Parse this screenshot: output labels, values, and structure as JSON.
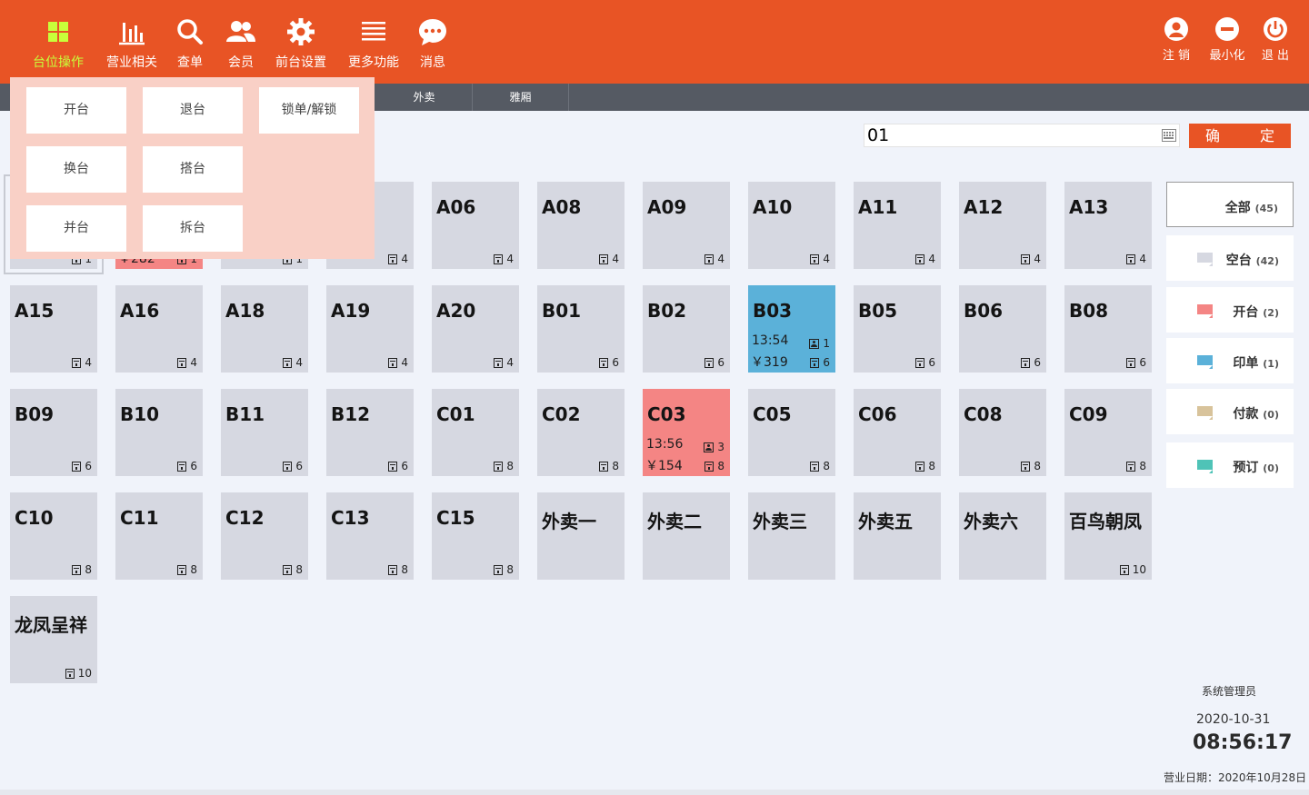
{
  "nav": {
    "items": [
      {
        "label": "台位操作",
        "icon": "grid-icon"
      },
      {
        "label": "营业相关",
        "icon": "bar-chart-icon"
      },
      {
        "label": "查单",
        "icon": "search-icon"
      },
      {
        "label": "会员",
        "icon": "users-icon"
      },
      {
        "label": "前台设置",
        "icon": "gear-icon"
      },
      {
        "label": "更多功能",
        "icon": "menu-icon"
      },
      {
        "label": "消息",
        "icon": "chat-icon"
      }
    ],
    "window": [
      {
        "label": "注 销",
        "icon": "user-logout-icon"
      },
      {
        "label": "最小化",
        "icon": "minimize-icon"
      },
      {
        "label": "退 出",
        "icon": "power-icon"
      }
    ]
  },
  "subtabs": [
    "外卖",
    "雅厢"
  ],
  "search": {
    "value": "01",
    "confirm_label": "确　定"
  },
  "popup": {
    "buttons": [
      "开台",
      "退台",
      "锁单/解锁",
      "换台",
      "搭台",
      "并台",
      "拆台"
    ]
  },
  "tables_partial": [
    {
      "name": "",
      "seats": "1"
    },
    {
      "name": "",
      "amount": "￥282",
      "guests": "1"
    },
    {
      "name": "",
      "seats": "1"
    },
    {
      "name": "",
      "seats": "4"
    }
  ],
  "tables": [
    {
      "name": "A06",
      "seats": "4",
      "status": "empty"
    },
    {
      "name": "A08",
      "seats": "4",
      "status": "empty"
    },
    {
      "name": "A09",
      "seats": "4",
      "status": "empty"
    },
    {
      "name": "A10",
      "seats": "4",
      "status": "empty"
    },
    {
      "name": "A11",
      "seats": "4",
      "status": "empty"
    },
    {
      "name": "A12",
      "seats": "4",
      "status": "empty"
    },
    {
      "name": "A13",
      "seats": "4",
      "status": "empty"
    },
    {
      "name": "A15",
      "seats": "4",
      "status": "empty"
    },
    {
      "name": "A16",
      "seats": "4",
      "status": "empty"
    },
    {
      "name": "A18",
      "seats": "4",
      "status": "empty"
    },
    {
      "name": "A19",
      "seats": "4",
      "status": "empty"
    },
    {
      "name": "A20",
      "seats": "4",
      "status": "empty"
    },
    {
      "name": "B01",
      "seats": "6",
      "status": "empty"
    },
    {
      "name": "B02",
      "seats": "6",
      "status": "empty"
    },
    {
      "name": "B03",
      "seats": "6",
      "status": "printed",
      "time": "13:54",
      "amount": "￥319",
      "guests": "1"
    },
    {
      "name": "B05",
      "seats": "6",
      "status": "empty"
    },
    {
      "name": "B06",
      "seats": "6",
      "status": "empty"
    },
    {
      "name": "B08",
      "seats": "6",
      "status": "empty"
    },
    {
      "name": "B09",
      "seats": "6",
      "status": "empty"
    },
    {
      "name": "B10",
      "seats": "6",
      "status": "empty"
    },
    {
      "name": "B11",
      "seats": "6",
      "status": "empty"
    },
    {
      "name": "B12",
      "seats": "6",
      "status": "empty"
    },
    {
      "name": "C01",
      "seats": "8",
      "status": "empty"
    },
    {
      "name": "C02",
      "seats": "8",
      "status": "empty"
    },
    {
      "name": "C03",
      "seats": "8",
      "status": "open",
      "time": "13:56",
      "amount": "￥154",
      "guests": "3"
    },
    {
      "name": "C05",
      "seats": "8",
      "status": "empty"
    },
    {
      "name": "C06",
      "seats": "8",
      "status": "empty"
    },
    {
      "name": "C08",
      "seats": "8",
      "status": "empty"
    },
    {
      "name": "C09",
      "seats": "8",
      "status": "empty"
    },
    {
      "name": "C10",
      "seats": "8",
      "status": "empty"
    },
    {
      "name": "C11",
      "seats": "8",
      "status": "empty"
    },
    {
      "name": "C12",
      "seats": "8",
      "status": "empty"
    },
    {
      "name": "C13",
      "seats": "8",
      "status": "empty"
    },
    {
      "name": "C15",
      "seats": "8",
      "status": "empty"
    },
    {
      "name": "外卖一",
      "seats": "",
      "status": "empty"
    },
    {
      "name": "外卖二",
      "seats": "",
      "status": "empty"
    },
    {
      "name": "外卖三",
      "seats": "",
      "status": "empty"
    },
    {
      "name": "外卖五",
      "seats": "",
      "status": "empty"
    },
    {
      "name": "外卖六",
      "seats": "",
      "status": "empty"
    },
    {
      "name": "百鸟朝凤",
      "seats": "10",
      "status": "empty"
    },
    {
      "name": "龙凤呈祥",
      "seats": "10",
      "status": "empty"
    }
  ],
  "filters": [
    {
      "label": "全部",
      "count": "(45)",
      "color": ""
    },
    {
      "label": "空台",
      "count": "(42)",
      "color": "#d6d8e1"
    },
    {
      "label": "开台",
      "count": "(2)",
      "color": "#f48584"
    },
    {
      "label": "印单",
      "count": "(1)",
      "color": "#5bb1d9"
    },
    {
      "label": "付款",
      "count": "(0)",
      "color": "#d8c39b"
    },
    {
      "label": "预订",
      "count": "(0)",
      "color": "#4fc3b7"
    }
  ],
  "footer": {
    "user": "系统管理员",
    "date": "2020-10-31",
    "time": "08:56:17",
    "business_date": "营业日期：2020年10月28日"
  },
  "colors": {
    "brand": "#e85425",
    "active_nav": "#c8ff3a",
    "empty": "#d6d8e1",
    "open": "#f48584",
    "printed": "#5bb1d9"
  }
}
